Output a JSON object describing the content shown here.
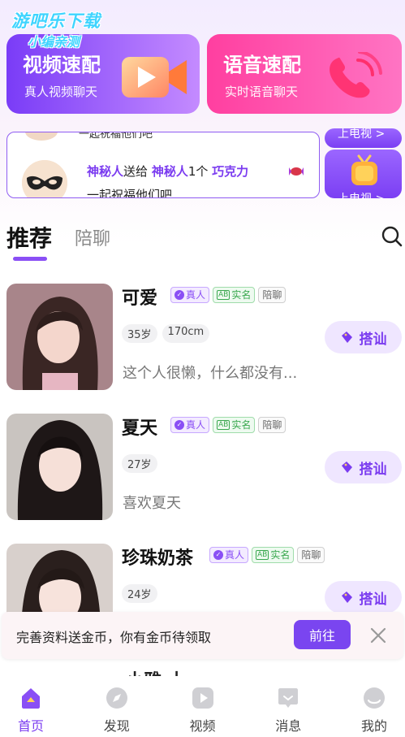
{
  "watermark": {
    "line1": "游吧乐下载",
    "line2": "小编亲测"
  },
  "match": {
    "video": {
      "title": "视频速配",
      "subtitle": "真人视频聊天"
    },
    "voice": {
      "title": "语音速配",
      "subtitle": "实时语音聊天"
    }
  },
  "gift": {
    "prev_text": "一起祝福他们吧",
    "sender": "神秘人",
    "verb": "送给",
    "receiver": "神秘人",
    "count": "1个",
    "item": "巧克力",
    "line2": "一起祝福他们吧",
    "tv_label": "上电视 >"
  },
  "tabs": {
    "active": "推荐",
    "other": "陪聊"
  },
  "users": [
    {
      "name": "可爱",
      "badge_real": "真人",
      "badge_name": "实名",
      "badge_chat": "陪聊",
      "chips": [
        "35岁",
        "170cm"
      ],
      "bio": "这个人很懒，什么都没有...",
      "action": "搭讪"
    },
    {
      "name": "夏天",
      "badge_real": "真人",
      "badge_name": "实名",
      "badge_chat": "陪聊",
      "chips": [
        "27岁"
      ],
      "bio": "喜欢夏天",
      "action": "搭讪"
    },
    {
      "name": "珍珠奶茶",
      "badge_real": "真人",
      "badge_name": "实名",
      "badge_chat": "陪聊",
      "chips": [
        "24岁"
      ],
      "bio": "",
      "action": "搭讪"
    }
  ],
  "banner": {
    "text": "完善资料送金币，你有金币待领取",
    "button": "前往"
  },
  "peek_name": "小雅 士",
  "nav": [
    {
      "label": "首页",
      "icon": "home-icon",
      "active": true
    },
    {
      "label": "发现",
      "icon": "discover-icon"
    },
    {
      "label": "视频",
      "icon": "video-icon"
    },
    {
      "label": "消息",
      "icon": "message-icon"
    },
    {
      "label": "我的",
      "icon": "profile-icon"
    }
  ],
  "colors": {
    "accent": "#7b3cf0",
    "video_card": "#7a3cf7",
    "voice_card": "#ff3fa0",
    "real_badge": "#8a4ff5",
    "name_badge": "#3aa84f"
  }
}
